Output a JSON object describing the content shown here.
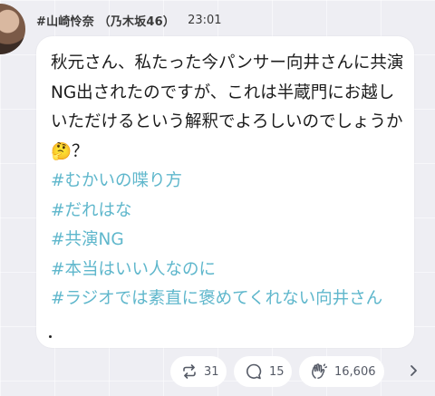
{
  "post": {
    "author": "#山崎怜奈 （乃木坂46）",
    "time": "23:01",
    "message": "秋元さん、私たった今パンサー向井さんに共演NG出されたのですが、これは半蔵門にお越しいただけるという解釈でよろしいのでしょうか🤔？",
    "hashtags": [
      "#むかいの喋り方",
      "#だれはな",
      "#共演NG",
      "#本当はいい人なのに",
      "#ラジオでは素直に褒めてくれない向井さん"
    ]
  },
  "actions": {
    "repost_count": "31",
    "reply_count": "15",
    "like_count": "16,606"
  },
  "icons": {
    "repost": "repost-icon",
    "reply": "reply-bubble-icon",
    "like": "clap-hands-icon",
    "more": "chevron-right-icon"
  },
  "colors": {
    "background": "#eeeef3",
    "bubble": "#ffffff",
    "hashtag": "#5fb7cc",
    "text": "#1c1c1c"
  }
}
